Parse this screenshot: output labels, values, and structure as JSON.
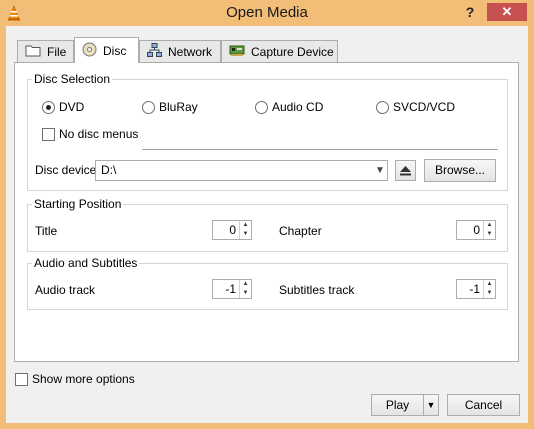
{
  "window": {
    "title": "Open Media",
    "help": "?",
    "close": "✕"
  },
  "tabs": [
    {
      "label": "File",
      "icon": "folder-icon"
    },
    {
      "label": "Disc",
      "icon": "disc-icon"
    },
    {
      "label": "Network",
      "icon": "network-icon"
    },
    {
      "label": "Capture Device",
      "icon": "capture-card-icon"
    }
  ],
  "disc_selection": {
    "title": "Disc Selection",
    "options": [
      "DVD",
      "BluRay",
      "Audio CD",
      "SVCD/VCD"
    ],
    "selected": "DVD",
    "no_disc_menus": "No disc menus",
    "device_label": "Disc device",
    "device_value": "D:\\",
    "browse": "Browse..."
  },
  "starting_position": {
    "title": "Starting Position",
    "title_label": "Title",
    "title_value": "0",
    "chapter_label": "Chapter",
    "chapter_value": "0"
  },
  "audio_subtitles": {
    "title": "Audio and Subtitles",
    "audio_label": "Audio track",
    "audio_value": "-1",
    "subtitles_label": "Subtitles track",
    "subtitles_value": "-1"
  },
  "footer": {
    "show_more": "Show more options",
    "play": "Play",
    "cancel": "Cancel"
  },
  "colors": {
    "titlebar": "#f2bd77",
    "close": "#c75050"
  }
}
